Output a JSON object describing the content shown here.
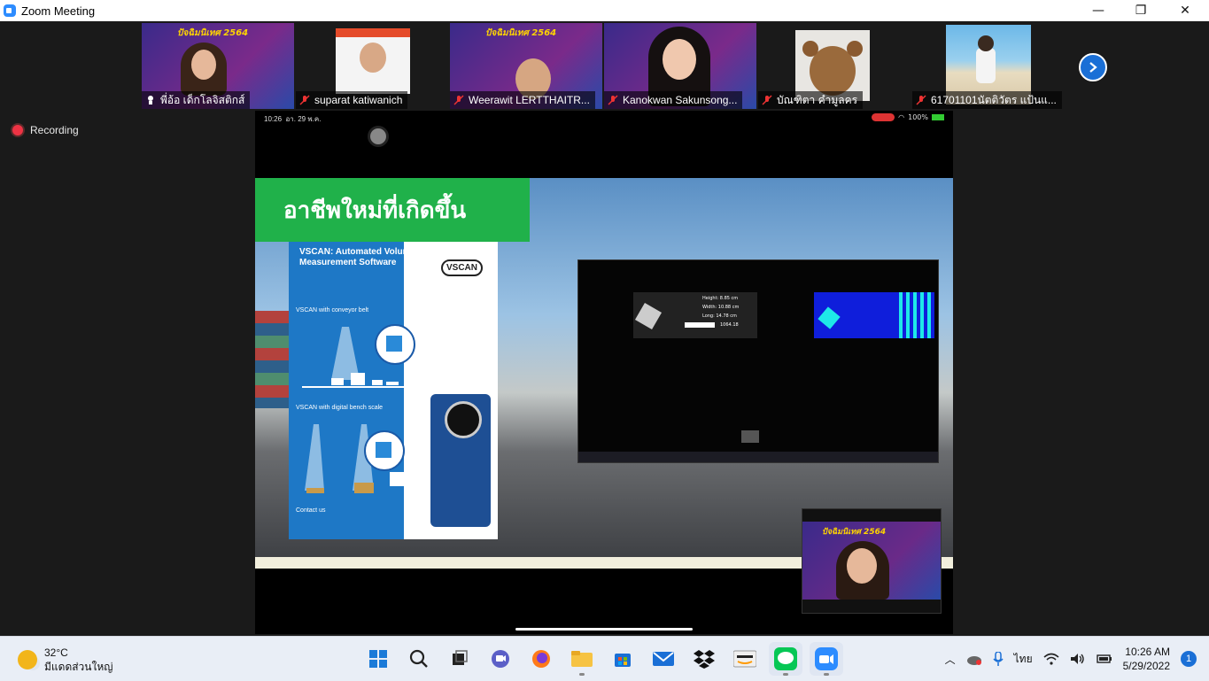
{
  "window": {
    "title": "Zoom Meeting"
  },
  "participants": [
    {
      "name": "พี่อ้อ เด็กโลจิสติกส์",
      "banner": "ปัจฉิมนิเทศ 2564",
      "active": true
    },
    {
      "name": "suparat katiwanich"
    },
    {
      "name": "Weerawit LERTTHAITR...",
      "banner": "ปัจฉิมนิเทศ 2564"
    },
    {
      "name": "Kanokwan Sakunsong..."
    },
    {
      "name": "บัณฑิตา คำมูลคร"
    },
    {
      "name": "61701101นัตติวัตร แป้นแ..."
    }
  ],
  "recording_label": "Recording",
  "phone_status": {
    "time": "10:26",
    "date": "อา. 29 พ.ค.",
    "battery": "100%"
  },
  "slide": {
    "heading": "อาชีพใหม่ที่เกิดขึ้น",
    "brochure_title_1": "VSCAN: Automated Volume",
    "brochure_title_2": "Measurement Software",
    "brochure_logo": "VSCAN",
    "conveyor_label": "VSCAN with conveyor belt",
    "bench_label": "VSCAN with digital bench scale",
    "contact_label": "Contact us",
    "measure_height": "Height: 8.85 cm",
    "measure_width": "Width: 10.88 cm",
    "measure_long": "Long: 14.78 cm",
    "measure_volume": "1064.18"
  },
  "pip_banner": "ปัจฉิมนิเทศ 2564",
  "taskbar": {
    "temperature": "32°C",
    "weather": "มีแดดส่วนใหญ่",
    "language": "ไทย",
    "time": "10:26 AM",
    "date": "5/29/2022",
    "notifications": "1"
  }
}
